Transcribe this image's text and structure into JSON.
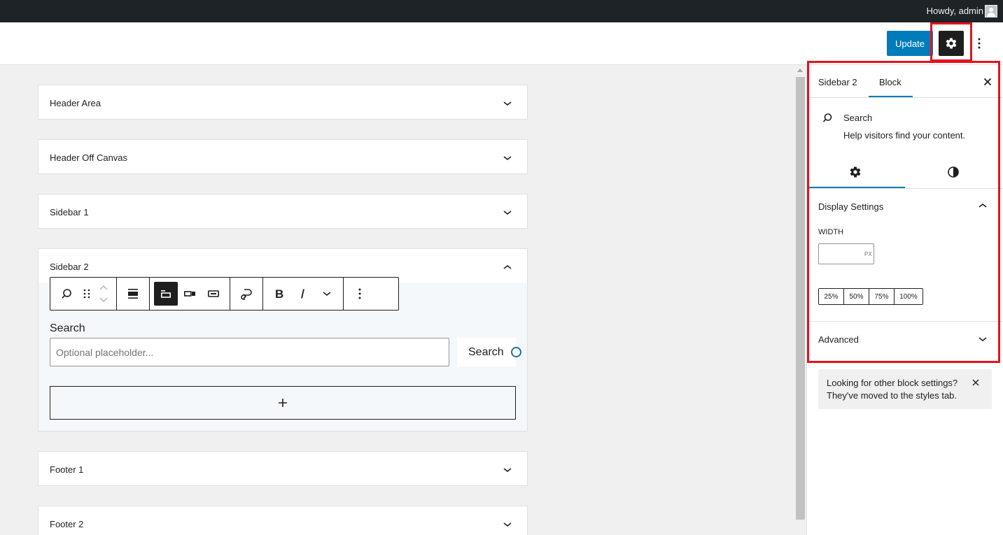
{
  "admin_bar": {
    "howdy": "Howdy, admin"
  },
  "header": {
    "update_label": "Update"
  },
  "panels": {
    "header_area": "Header Area",
    "header_off_canvas": "Header Off Canvas",
    "sidebar_1": "Sidebar 1",
    "sidebar_2": "Sidebar 2",
    "footer_1": "Footer 1",
    "footer_2": "Footer 2"
  },
  "search_block": {
    "label": "Search",
    "placeholder": "Optional placeholder...",
    "button_label": "Search"
  },
  "sidebar": {
    "tabs": [
      "Sidebar 2",
      "Block"
    ],
    "block_title": "Search",
    "block_description": "Help visitors find your content.",
    "display_settings": "Display Settings",
    "width_label": "WIDTH",
    "width_unit": "PX",
    "width_value": "",
    "percentages": [
      "25%",
      "50%",
      "75%",
      "100%"
    ],
    "advanced": "Advanced",
    "notice": "Looking for other block settings? They've moved to the styles tab."
  },
  "colors": {
    "accent": "#007cba",
    "highlight": "#e5121c",
    "admin_bar": "#1d2327"
  }
}
